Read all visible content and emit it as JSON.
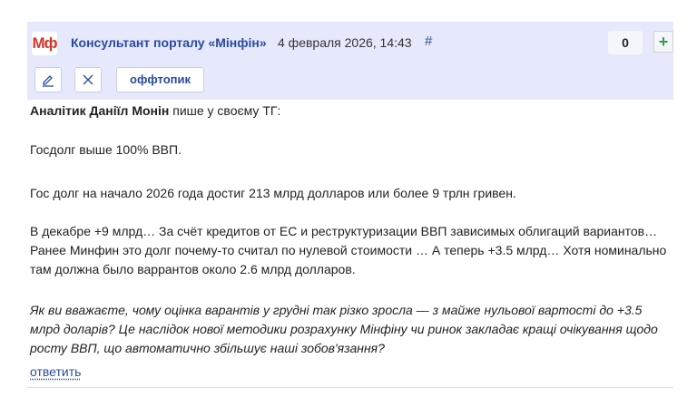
{
  "comment": {
    "logo_text": "Мф",
    "author": "Консультант порталу «Мінфін»",
    "date": "4 февраля 2026, 14:43",
    "permalink": "#",
    "score": "0",
    "vote_up": "+",
    "actions": {
      "edit_icon": "pencil-icon",
      "delete_icon": "close-icon",
      "offtopic_label": "оффтопик"
    },
    "body": {
      "intro_bold": "Аналітик Даніїл Монін",
      "intro_rest": " пише у своєму ТГ:",
      "p2": "Госдолг выше 100% ВВП.",
      "p3": "Гос долг на начало 2026 года достиг 213 млрд долларов или более 9 трлн гривен.",
      "p4": "В декабре +9 млрд… За счёт кредитов от ЕС и реструктуризации ВВП зависимых облигаций вариантов… Ранее Минфин это долг почему-то считал по нулевой стоимости … А теперь +3.5 млрд… Хотя номинально там должна было варрантов около 2.6 млрд долларов.",
      "p5": "Як ви вважаєте, чому оцінка варантів у грудні так різко зросла — з майже нульової вартості до +3.5 млрд доларів? Це наслідок нової методики розрахунку Мінфіну чи ринок закладає кращі очікування щодо росту ВВП, що автоматично збільшує наші зобов'язання?"
    },
    "reply_label": "ответить",
    "colors": {
      "header_bg": "#e6e9fb",
      "link": "#2a4aa0",
      "logo": "#d8352a",
      "upvote": "#3a9a4a"
    }
  }
}
